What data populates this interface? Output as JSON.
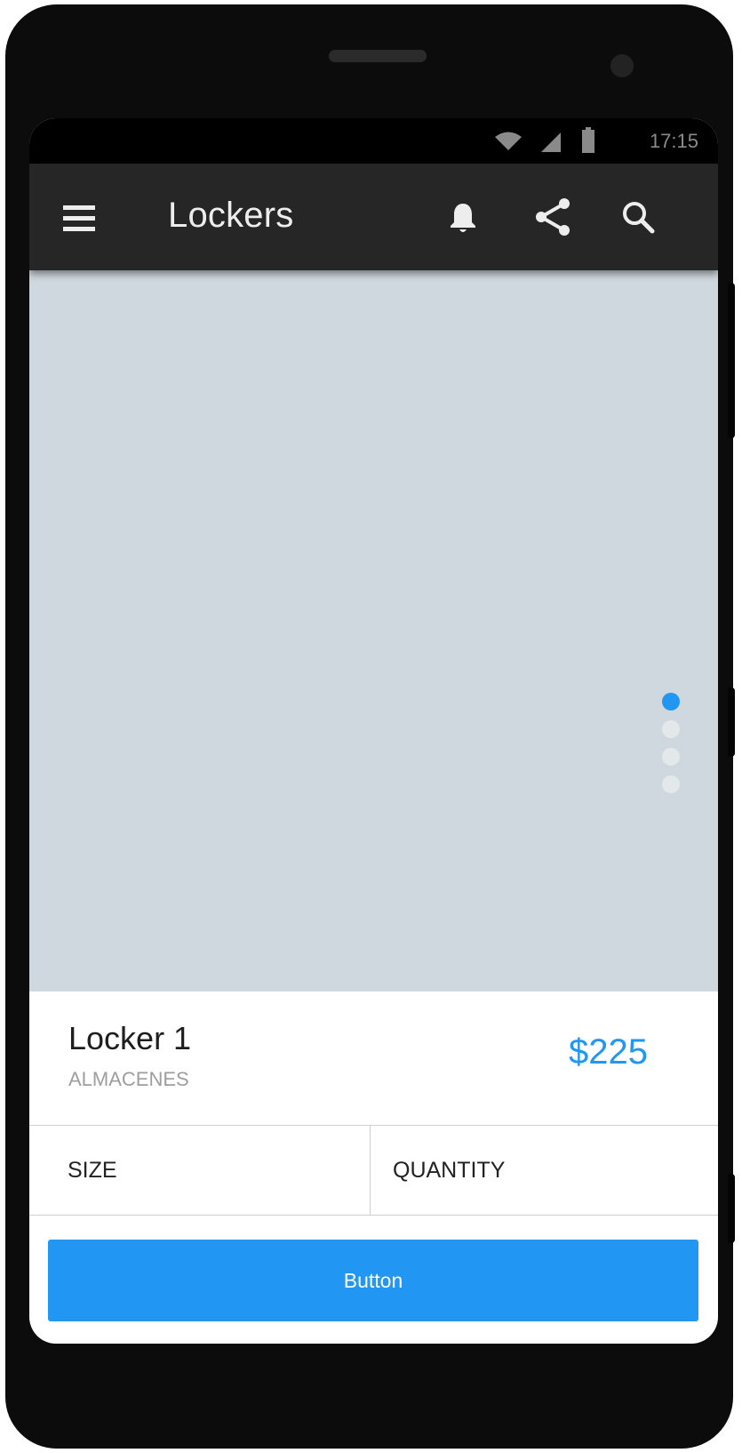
{
  "status_bar": {
    "time": "17:15",
    "icons": [
      "wifi-icon",
      "signal-icon",
      "battery-icon"
    ]
  },
  "app_bar": {
    "title": "Lockers",
    "menu_icon": "menu-icon",
    "actions": [
      "bell-icon",
      "share-icon",
      "search-icon"
    ]
  },
  "carousel": {
    "page_count": 4,
    "active_index": 0,
    "active_color": "#2196f3"
  },
  "item": {
    "title": "Locker 1",
    "subtitle": "ALMACENES",
    "price": "$225"
  },
  "options": {
    "size_label": "SIZE",
    "quantity_label": "QUANTITY"
  },
  "action": {
    "label": "Button",
    "color": "#2196f3"
  }
}
